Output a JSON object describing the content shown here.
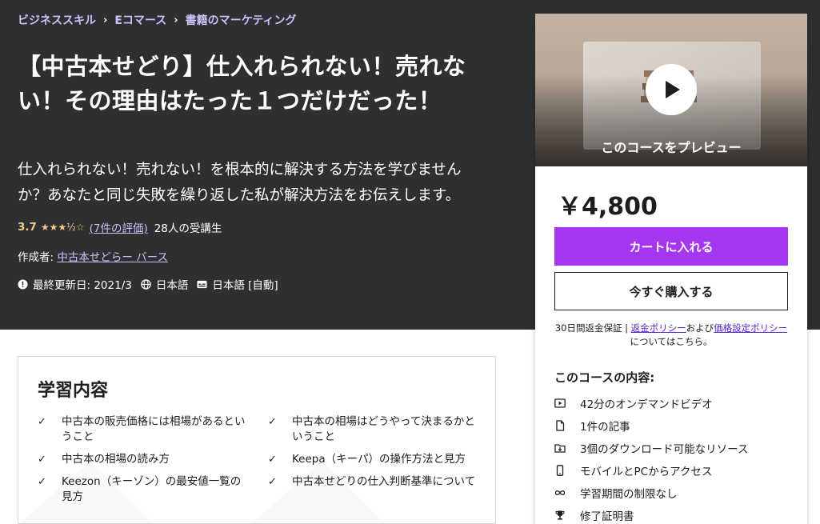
{
  "breadcrumb": [
    "ビジネススキル",
    "Eコマース",
    "書籍のマーケティング"
  ],
  "course": {
    "title": "【中古本せどり】仕入れられない！売れない！その理由はたった１つだけだった！",
    "subtitle": "仕入れられない！売れない！を根本的に解決する方法を学びませんか？あなたと同じ失敗を繰り返した私が解決方法をお伝えします。",
    "rating": "3.7",
    "stars": "★★★½☆",
    "ratings_count": "(7件の評価)",
    "students": "28人の受講生",
    "author_label": "作成者:",
    "author": "中古本せどらー バース",
    "last_updated": "最終更新日: 2021/3",
    "language": "日本語",
    "captions": "日本語 [自動]"
  },
  "sidebar": {
    "preview_label": "このコースをプレビュー",
    "price": "￥4,800",
    "cart_button": "カートに入れる",
    "buy_button": "今すぐ購入する",
    "policy_prefix": "30日間返金保証 | ",
    "refund_link": "返金ポリシー",
    "policy_and": "および",
    "pricing_link": "価格設定ポリシー",
    "policy_suffix": "についてはこちら。",
    "includes_title": "このコースの内容:",
    "includes": [
      {
        "icon": "video-icon",
        "text": "42分のオンデマンドビデオ"
      },
      {
        "icon": "file-icon",
        "text": "1件の記事"
      },
      {
        "icon": "download-icon",
        "text": "3個のダウンロード可能なリソース"
      },
      {
        "icon": "mobile-icon",
        "text": "モバイルとPCからアクセス"
      },
      {
        "icon": "infinity-icon",
        "text": "学習期間の制限なし"
      },
      {
        "icon": "trophy-icon",
        "text": "修了証明書"
      }
    ]
  },
  "learn": {
    "title": "学習内容",
    "left": [
      "中古本の販売価格には相場があるということ",
      "中古本の相場の読み方",
      "Keezon（キーゾン）の最安値一覧の見方"
    ],
    "right": [
      "中古本の相場はどうやって決まるかということ",
      "Keepa（キーパ）の操作方法と見方",
      "中古本せどりの仕入判断基準について"
    ]
  },
  "colors": {
    "hero_bg": "#2d2f31",
    "accent_purple": "#a435f0",
    "link_lavender": "#cec0fc",
    "star": "#f3ca8c"
  }
}
